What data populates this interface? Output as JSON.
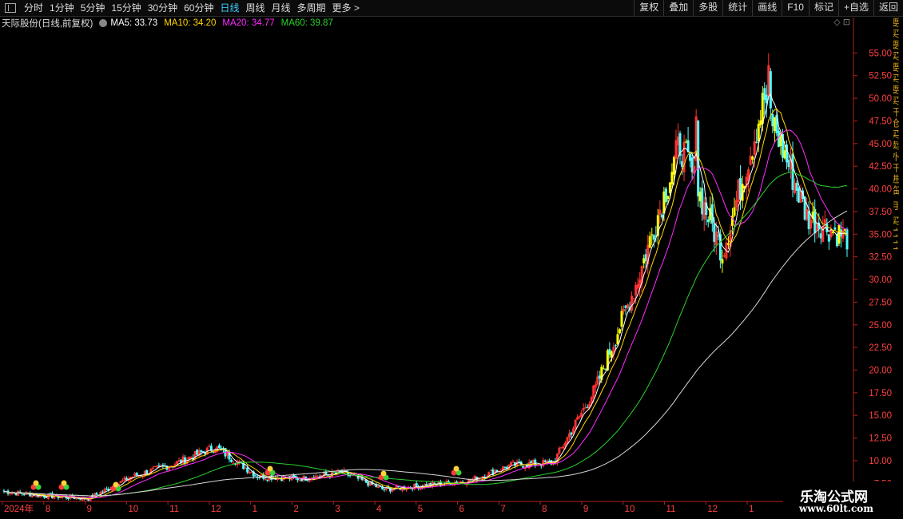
{
  "toolbar": {
    "periods": [
      "分时",
      "1分钟",
      "5分钟",
      "15分钟",
      "30分钟",
      "60分钟",
      "日线",
      "周线",
      "月线",
      "多周期",
      "更多 >"
    ],
    "active_period": "日线",
    "tools": [
      "复权",
      "叠加",
      "多股",
      "统计",
      "画线",
      "F10",
      "标记",
      "+自选",
      "返回"
    ]
  },
  "info": {
    "stock_name": "天际股份",
    "stock_sub": "(日线,前复权)",
    "ma": [
      {
        "label": "MA5: 33.73",
        "color": "#ffffff"
      },
      {
        "label": "MA10: 34.20",
        "color": "#ffd700"
      },
      {
        "label": "MA20: 34.77",
        "color": "#ff2bff"
      },
      {
        "label": "MA60: 39.87",
        "color": "#2bd12b"
      }
    ],
    "mode_icons": "◇  ⊡"
  },
  "side_strip": "要买要买要买要买开抢买卖外开进临 月 买1111",
  "watermark": {
    "line1": "乐淘公式网",
    "line2": "www.60lt.com"
  },
  "colors": {
    "up": "#ff3232",
    "down": "#54ffff",
    "bull": "#ffff00",
    "axis": "#b22222",
    "grid": "#3a0f0f"
  },
  "chart_data": {
    "type": "candlestick",
    "title": "天际股份 (日线,前复权)",
    "ylim": [
      5.5,
      57.5
    ],
    "y_ticks": [
      7.5,
      10.0,
      12.5,
      15.0,
      17.5,
      20.0,
      22.5,
      25.0,
      27.5,
      30.0,
      32.5,
      35.0,
      37.5,
      40.0,
      42.5,
      45.0,
      47.5,
      50.0,
      52.5,
      55.0
    ],
    "x_tick_labels": [
      "2024年",
      "8",
      "9",
      "10",
      "11",
      "12",
      "1",
      "2",
      "3",
      "4",
      "5",
      "6",
      "7",
      "8",
      "9",
      "10",
      "11",
      "12",
      "1"
    ],
    "ma_latest": {
      "MA5": 33.73,
      "MA10": 34.2,
      "MA20": 34.77,
      "MA60": 39.87
    },
    "price_path": [
      {
        "month": "2024-07",
        "price": 6.6
      },
      {
        "month": "2024-08",
        "price": 6.1
      },
      {
        "month": "2024-09",
        "price": 5.8
      },
      {
        "month": "2024-10",
        "price": 8.2
      },
      {
        "month": "2024-11",
        "price": 9.6
      },
      {
        "month": "2024-12",
        "price": 11.5
      },
      {
        "month": "2025-01",
        "price": 8.3
      },
      {
        "month": "2025-02",
        "price": 8.0
      },
      {
        "month": "2025-03",
        "price": 8.7
      },
      {
        "month": "2025-04",
        "price": 6.8
      },
      {
        "month": "2025-05",
        "price": 7.3
      },
      {
        "month": "2025-06",
        "price": 7.8
      },
      {
        "month": "2025-07",
        "price": 9.5
      },
      {
        "month": "2025-08",
        "price": 9.8
      },
      {
        "month": "2025-09",
        "price": 18.0
      },
      {
        "month": "2025-10",
        "price": 30.0
      },
      {
        "month": "2025-11",
        "price": 45.0
      },
      {
        "month": "2025-12",
        "price": 33.0
      },
      {
        "month": "2026-01",
        "price": 50.0
      },
      {
        "month": "2026-02",
        "price": 37.0
      },
      {
        "month": "2026-03",
        "price": 34.5
      }
    ],
    "peaks": [
      {
        "label": "2025-11 high",
        "value": 50.0
      },
      {
        "label": "2026-01 high",
        "value": 55.9
      }
    ]
  }
}
